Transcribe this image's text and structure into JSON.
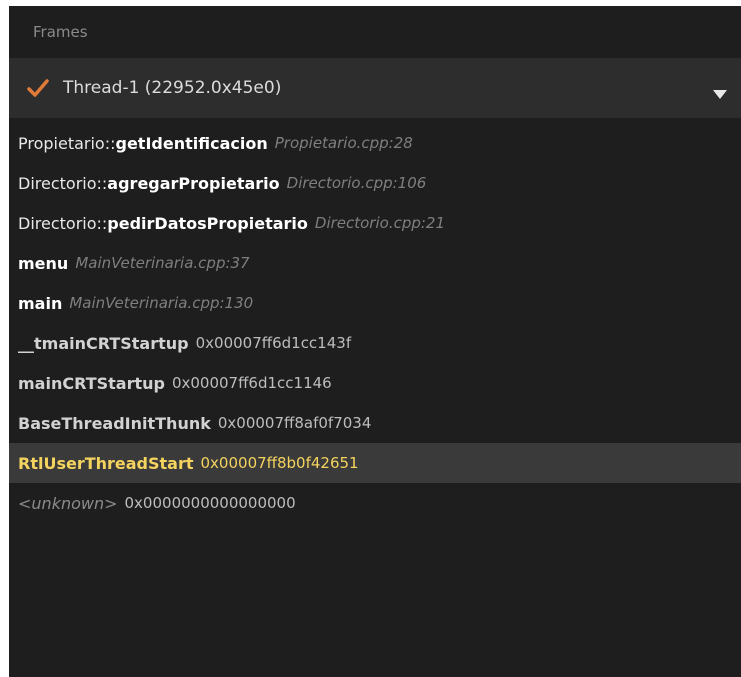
{
  "panel": {
    "title": "Frames"
  },
  "thread": {
    "label": "Thread-1 (22952.0x45e0)",
    "status_icon": "checkmark-icon",
    "dropdown_icon": "chevron-down-icon",
    "accent_color": "#e07b39"
  },
  "frames": [
    {
      "prefix": "Propietario::",
      "function": "getIdentificacion",
      "location": "Propietario.cpp:28"
    },
    {
      "prefix": "Directorio::",
      "function": "agregarPropietario",
      "location": "Directorio.cpp:106"
    },
    {
      "prefix": "Directorio::",
      "function": "pedirDatosPropietario",
      "location": "Directorio.cpp:21"
    },
    {
      "prefix": "",
      "function": "menu",
      "location": "MainVeterinaria.cpp:37"
    },
    {
      "prefix": "",
      "function": "main",
      "location": "MainVeterinaria.cpp:130"
    },
    {
      "prefix": "",
      "function": "__tmainCRTStartup",
      "address": "0x00007ff6d1cc143f"
    },
    {
      "prefix": "",
      "function": "mainCRTStartup",
      "address": "0x00007ff6d1cc1146"
    },
    {
      "prefix": "",
      "function": "BaseThreadInitThunk",
      "address": "0x00007ff8af0f7034"
    },
    {
      "prefix": "",
      "function": "RtlUserThreadStart",
      "address": "0x00007ff8b0f42651",
      "current": true
    },
    {
      "prefix": "",
      "function": "<unknown>",
      "address": "0x0000000000000000"
    }
  ],
  "colors": {
    "current_frame": "#f5d35f",
    "background": "#1e1e1e"
  }
}
